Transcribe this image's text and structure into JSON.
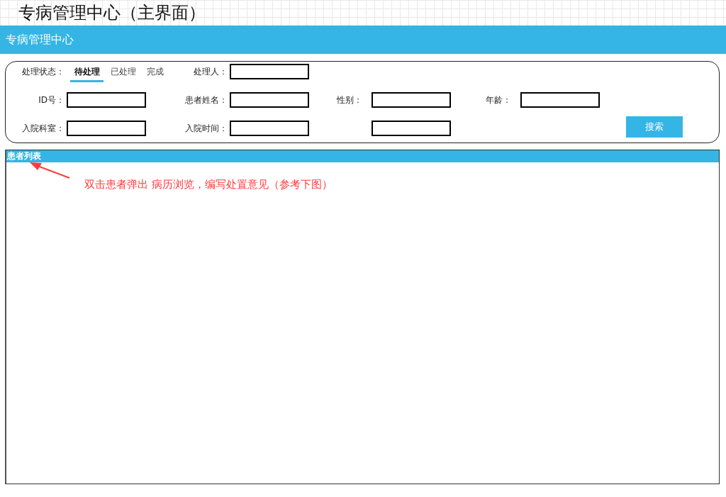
{
  "page_title": "专病管理中心（主界面）",
  "header": {
    "title": "专病管理中心"
  },
  "filter": {
    "rows": [
      {
        "items": [
          {
            "kind": "tabs",
            "label": "处理状态：",
            "tabs": [
              {
                "label": "待处理",
                "selected": true
              },
              {
                "label": "已处理",
                "selected": false
              },
              {
                "label": "完成",
                "selected": false
              }
            ]
          },
          {
            "kind": "field",
            "label": "处理人："
          }
        ]
      },
      {
        "items": [
          {
            "kind": "field",
            "label": "ID号："
          },
          {
            "kind": "field",
            "label": "患者姓名："
          },
          {
            "kind": "field",
            "label": "性别："
          },
          {
            "kind": "field",
            "label": "年龄："
          }
        ]
      },
      {
        "items": [
          {
            "kind": "field",
            "label": "入院科室："
          },
          {
            "kind": "field",
            "label": "入院时间："
          },
          {
            "kind": "field"
          },
          {
            "kind": "button",
            "label": "搜索"
          }
        ]
      }
    ]
  },
  "patient_list": {
    "title": "患者列表",
    "annotation": "双击患者弹出 病历浏览，编写处置意见（参考下图）"
  }
}
